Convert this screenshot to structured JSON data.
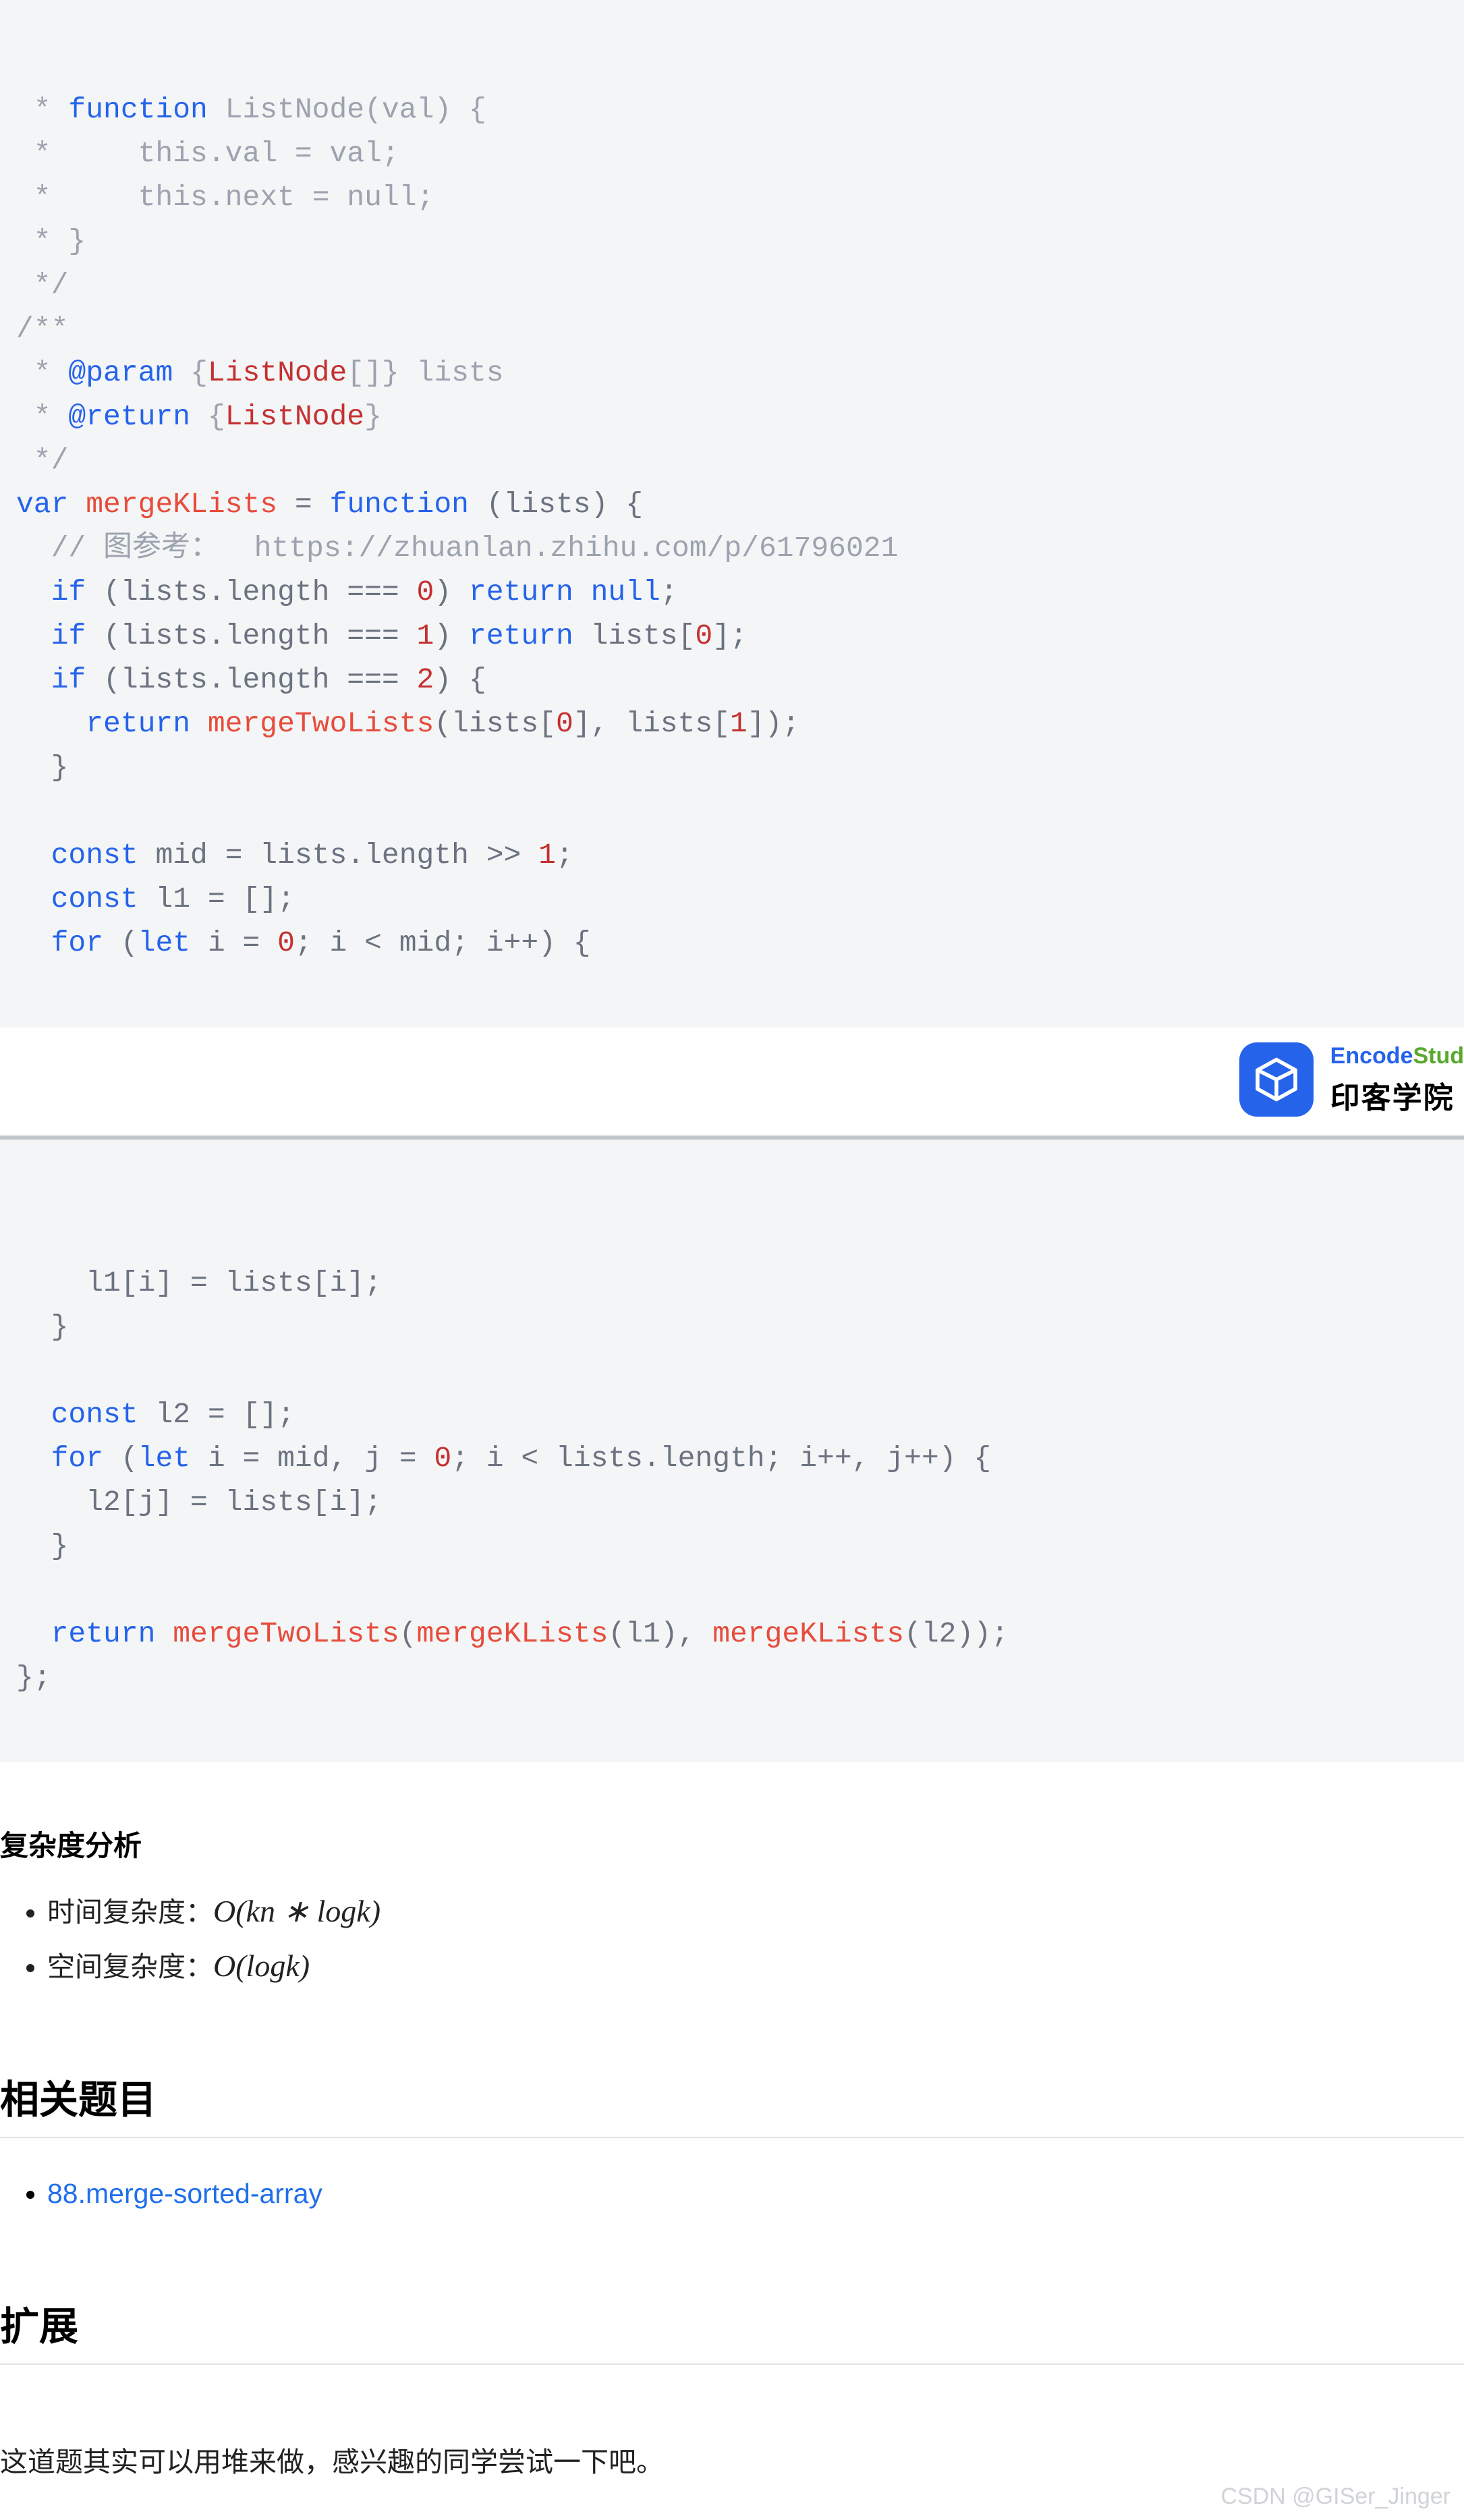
{
  "code_top": {
    "l1_a": " * ",
    "l1_b": "function",
    "l1_c": " ListNode(val) {",
    "l2": " *     this.val = val;",
    "l3": " *     this.next = null;",
    "l4": " * }",
    "l5": " */",
    "l6": "/**",
    "l7_a": " * ",
    "l7_b": "@param",
    "l7_c": " {",
    "l7_d": "ListNode",
    "l7_e": "[]} lists",
    "l8_a": " * ",
    "l8_b": "@return",
    "l8_c": " {",
    "l8_d": "ListNode",
    "l8_e": "}",
    "l9": " */",
    "l10_a": "var",
    "l10_b": " ",
    "l10_c": "mergeKLists",
    "l10_d": " = ",
    "l10_e": "function",
    "l10_f": " (lists) {",
    "l11": "  // 图参考：  https://zhuanlan.zhihu.com/p/61796021",
    "l12_a": "  ",
    "l12_b": "if",
    "l12_c": " (lists.length === ",
    "l12_d": "0",
    "l12_e": ") ",
    "l12_f": "return",
    "l12_g": " ",
    "l12_h": "null",
    "l12_i": ";",
    "l13_a": "  ",
    "l13_b": "if",
    "l13_c": " (lists.length === ",
    "l13_d": "1",
    "l13_e": ") ",
    "l13_f": "return",
    "l13_g": " lists[",
    "l13_h": "0",
    "l13_i": "];",
    "l14_a": "  ",
    "l14_b": "if",
    "l14_c": " (lists.length === ",
    "l14_d": "2",
    "l14_e": ") {",
    "l15_a": "    ",
    "l15_b": "return",
    "l15_c": " ",
    "l15_d": "mergeTwoLists",
    "l15_e": "(lists[",
    "l15_f": "0",
    "l15_g": "], lists[",
    "l15_h": "1",
    "l15_i": "]);",
    "l16": "  }",
    "l17": "",
    "l18_a": "  ",
    "l18_b": "const",
    "l18_c": " mid = lists.length >> ",
    "l18_d": "1",
    "l18_e": ";",
    "l19_a": "  ",
    "l19_b": "const",
    "l19_c": " l1 = [];",
    "l20_a": "  ",
    "l20_b": "for",
    "l20_c": " (",
    "l20_d": "let",
    "l20_e": " i = ",
    "l20_f": "0",
    "l20_g": "; i < mid; i++) {"
  },
  "logo": {
    "en1": "Encode",
    "en2": "Stud",
    "cn": "印客学院"
  },
  "code_bottom": {
    "l1": "    l1[i] = lists[i];",
    "l2": "  }",
    "l3": "",
    "l4_a": "  ",
    "l4_b": "const",
    "l4_c": " l2 = [];",
    "l5_a": "  ",
    "l5_b": "for",
    "l5_c": " (",
    "l5_d": "let",
    "l5_e": " i = mid, j = ",
    "l5_f": "0",
    "l5_g": "; i < lists.length; i++, j++) {",
    "l6": "    l2[j] = lists[i];",
    "l7": "  }",
    "l8": "",
    "l9_a": "  ",
    "l9_b": "return",
    "l9_c": " ",
    "l9_d": "mergeTwoLists",
    "l9_e": "(",
    "l9_f": "mergeKLists",
    "l9_g": "(l1), ",
    "l9_h": "mergeKLists",
    "l9_i": "(l2));",
    "l10": "};"
  },
  "sections": {
    "complexity_heading": "复杂度分析",
    "time_label": "时间复杂度：",
    "time_formula": "O(kn ∗ logk)",
    "space_label": "空间复杂度：",
    "space_formula": "O(logk)",
    "related_heading": "相关题目",
    "related_link": "88.merge-sorted-array",
    "extension_heading": "扩展",
    "extension_body": "这道题其实可以用堆来做，感兴趣的同学尝试一下吧。"
  },
  "watermark": "CSDN @GISer_Jinger"
}
